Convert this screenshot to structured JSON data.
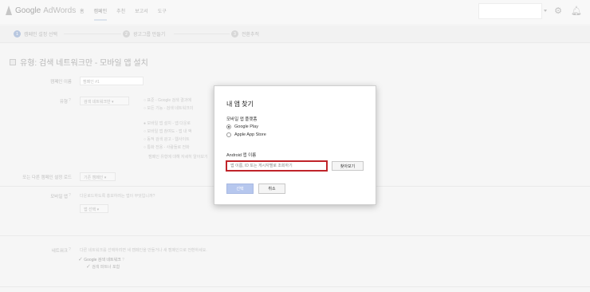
{
  "header": {
    "logo_google": "Google",
    "logo_adwords": "AdWords",
    "nav_tabs": [
      "홈",
      "캠페인",
      "추천",
      "보고서",
      "도구"
    ]
  },
  "steps": [
    {
      "num": "1",
      "label": "캠페인 설정 선택"
    },
    {
      "num": "2",
      "label": "광고그룹 만들기"
    },
    {
      "num": "3",
      "label": "전환추적"
    }
  ],
  "page": {
    "title": "유형: 검색 네트워크만 - 모바일 앱 설치",
    "campaign_name_label": "캠페인 이름",
    "campaign_name_value": "캠페인 #1",
    "type_label": "유형",
    "type_value": "검색 네트워크만",
    "type_options": [
      "표준 - Google 검색 결과에",
      "모든 기능 - 검색 네트워크의",
      "모바일 앱 설치 - 앱 다운로",
      "모바일 앱 참여도 - 앱 내 액",
      "동적 검색 광고 - 웹사이트",
      "통화 전용 - 사람들로 전화",
      "캠페인 유형에 대해 자세히 알아보기"
    ],
    "load_settings_label": "또는 다른 캠페인 설정 로드",
    "load_settings_value": "기존 캠페인",
    "mobile_app_label": "모바일 앱",
    "mobile_app_question": "다운로드하도록 홍보하려는 앱이 무엇입니까?",
    "select_app_value": "앱 선택",
    "network_label": "네트워크",
    "network_desc": "다른 네트워크를 선택하려면 새 캠페인을 만들거나 새 캠페인으로 전환하세요.",
    "network_google_search": "Google 검색 네트워크",
    "network_search_partners": "검색 파트너 포함"
  },
  "dialog": {
    "title": "내 앱 찾기",
    "platform_label": "모바일 앱 플랫폼",
    "platforms": [
      "Google Play",
      "Apple App Store"
    ],
    "selected_platform": "Google Play",
    "app_name_label": "Android 앱 이름",
    "app_name_placeholder": "앱 이름, ID 또는 게시자별로 조회하기",
    "find_button": "찾아보기",
    "select_button": "선택",
    "cancel_button": "취소"
  },
  "colors": {
    "highlight_border": "#c0242a",
    "select_button_bg": "#b6c7ee"
  }
}
